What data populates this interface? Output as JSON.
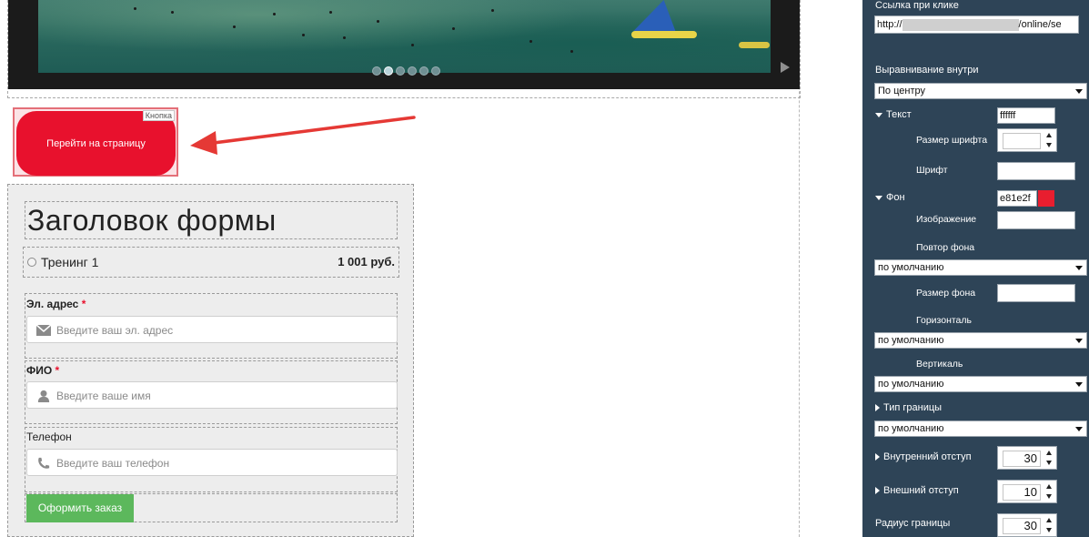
{
  "slider": {
    "dots_count": 6,
    "active_dot_index": 1
  },
  "button_block": {
    "tag_label": "Кнопка",
    "button_label": "Перейти на страницу",
    "button_color": "#e8112d"
  },
  "form": {
    "title": "Заголовок формы",
    "product": {
      "name": "Тренинг 1",
      "price": "1 001 руб."
    },
    "fields": [
      {
        "label": "Эл. адрес",
        "required": "*",
        "placeholder": "Введите ваш эл. адрес",
        "icon": "envelope-icon"
      },
      {
        "label": "ФИО",
        "required": "*",
        "placeholder": "Введите ваше имя",
        "icon": "user-icon"
      },
      {
        "label": "Телефон",
        "required": "",
        "placeholder": "Введите ваш телефон",
        "icon": "phone-icon"
      }
    ],
    "submit_label": "Оформить заказ",
    "submit_color": "#5cb85c"
  },
  "panel": {
    "link_label": "Ссылка при клике",
    "link_value_prefix": "http://",
    "link_value_suffix": "/online/se",
    "align_label": "Выравнивание внутри",
    "align_value": "По центру",
    "text_label": "Текст",
    "text_color": "ffffff",
    "font_size_label": "Размер шрифта",
    "font_label": "Шрифт",
    "bg_label": "Фон",
    "bg_color": "e81e2f",
    "image_label": "Изображение",
    "bg_repeat_label": "Повтор фона",
    "bg_repeat_value": "по умолчанию",
    "bg_size_label": "Размер фона",
    "horizontal_label": "Горизонталь",
    "horizontal_value": "по умолчанию",
    "vertical_label": "Вертикаль",
    "vertical_value": "по умолчанию",
    "border_type_label": "Тип границы",
    "border_type_value": "по умолчанию",
    "padding_label": "Внутренний отступ",
    "padding_value": "30",
    "margin_label": "Внешний отступ",
    "margin_value": "10",
    "radius_label": "Радиус границы",
    "radius_value": "30",
    "panel_color": "#2e4457"
  }
}
